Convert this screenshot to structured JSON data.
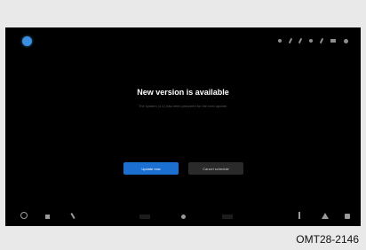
{
  "dialog": {
    "title": "New version is available",
    "message": "The system (1.1) has been prepared for the next update.",
    "update_label": "Update now",
    "cancel_label": "Cancel schedule"
  },
  "caption": "OMT28-2146",
  "icons": {
    "logo": "app-logo-icon",
    "status": [
      "bluetooth-icon",
      "signal-icon",
      "network-icon",
      "wifi-icon",
      "phone-icon",
      "battery-icon",
      "settings-icon"
    ],
    "bottom": [
      "home-icon",
      "apps-icon",
      "phone-icon",
      "media-prev-icon",
      "center-icon",
      "media-next-icon",
      "music-icon",
      "navigation-icon",
      "settings-icon"
    ]
  },
  "colors": {
    "accent": "#1a6fd1",
    "background": "#000000"
  }
}
